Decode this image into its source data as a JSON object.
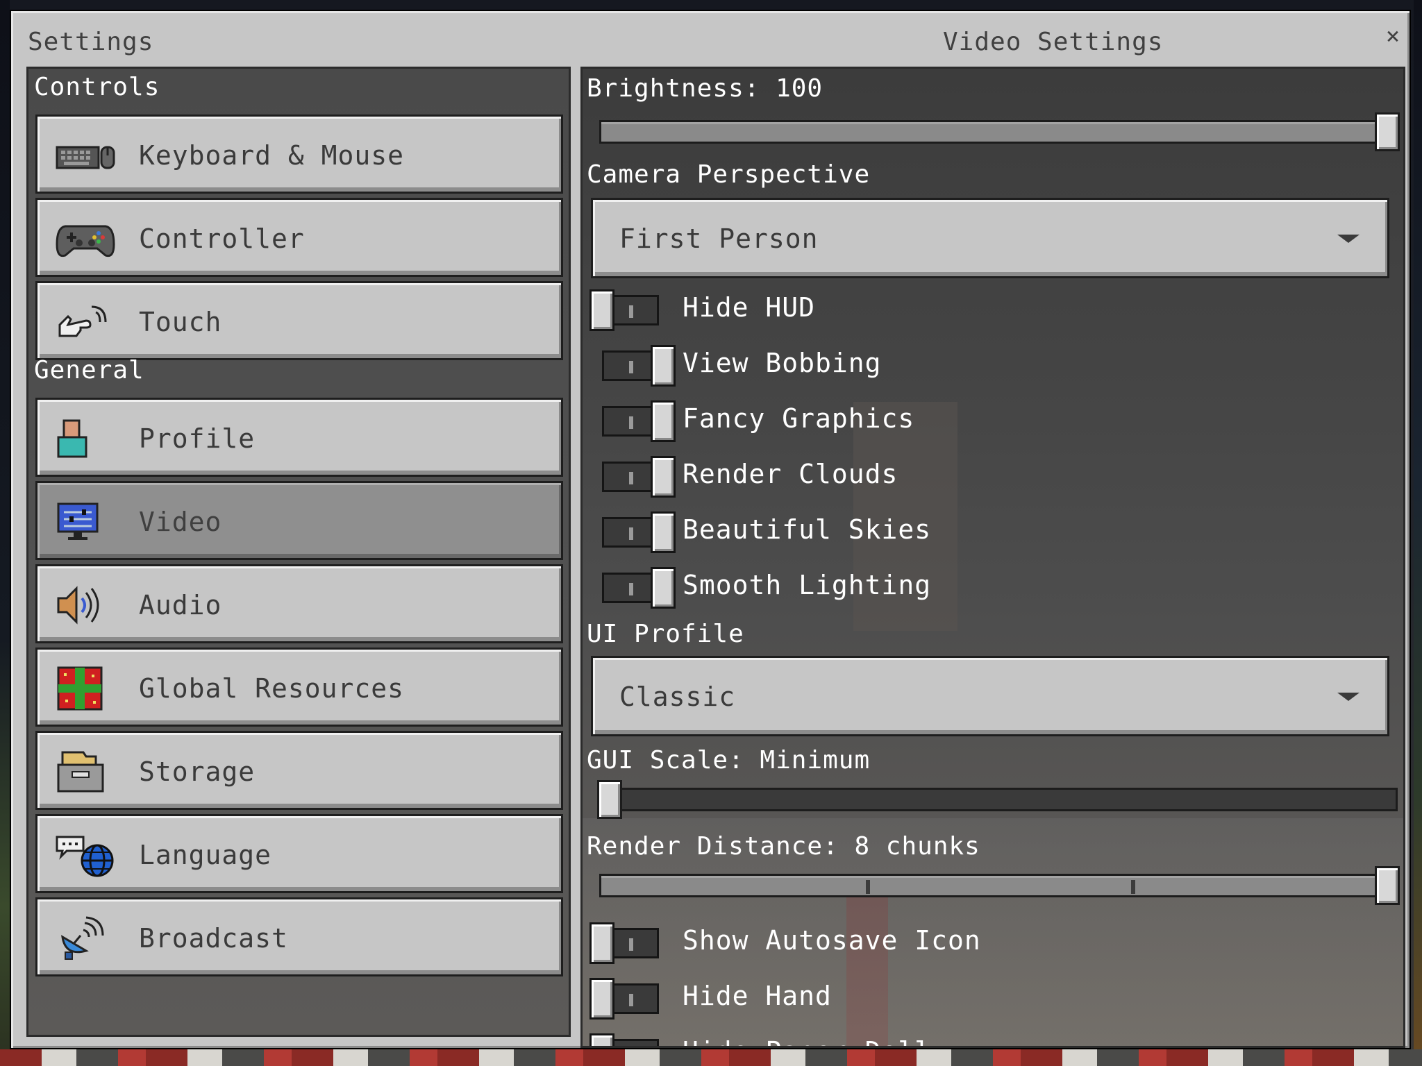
{
  "window": {
    "title_left": "Settings",
    "title_right": "Video Settings",
    "close_glyph": "×"
  },
  "sidebar": {
    "controls_heading": "Controls",
    "general_heading": "General",
    "controls_items": [
      {
        "label": "Keyboard & Mouse",
        "icon": "keyboard-mouse-icon"
      },
      {
        "label": "Controller",
        "icon": "gamepad-icon"
      },
      {
        "label": "Touch",
        "icon": "touch-hand-icon"
      }
    ],
    "general_items": [
      {
        "label": "Profile",
        "icon": "profile-icon"
      },
      {
        "label": "Video",
        "icon": "monitor-icon",
        "selected": true
      },
      {
        "label": "Audio",
        "icon": "speaker-icon"
      },
      {
        "label": "Global Resources",
        "icon": "gift-box-icon"
      },
      {
        "label": "Storage",
        "icon": "storage-box-icon"
      },
      {
        "label": "Language",
        "icon": "language-globe-icon"
      },
      {
        "label": "Broadcast",
        "icon": "satellite-dish-icon"
      }
    ]
  },
  "video": {
    "brightness": {
      "label": "Brightness: 100",
      "value": 100,
      "min": 0,
      "max": 100
    },
    "camera_perspective": {
      "label": "Camera Perspective",
      "value": "First Person"
    },
    "toggles_a": [
      {
        "label": "Hide HUD",
        "on": false
      },
      {
        "label": "View Bobbing",
        "on": true
      },
      {
        "label": "Fancy Graphics",
        "on": true
      },
      {
        "label": "Render Clouds",
        "on": true
      },
      {
        "label": "Beautiful Skies",
        "on": true
      },
      {
        "label": "Smooth Lighting",
        "on": true
      }
    ],
    "ui_profile": {
      "label": "UI Profile",
      "value": "Classic"
    },
    "gui_scale": {
      "label": "GUI Scale: Minimum",
      "fraction": 0.0
    },
    "render_distance": {
      "label": "Render Distance: 8 chunks",
      "fraction": 1.0,
      "ticks": 2
    },
    "toggles_b": [
      {
        "label": "Show Autosave Icon",
        "on": false
      },
      {
        "label": "Hide Hand",
        "on": false
      },
      {
        "label": "Hide Paper Doll",
        "on": false
      }
    ]
  },
  "colors": {
    "panel_gray": "#c6c6c6",
    "dark_panel": "#4a4a4a",
    "selected_gray": "#8f8f8f"
  }
}
